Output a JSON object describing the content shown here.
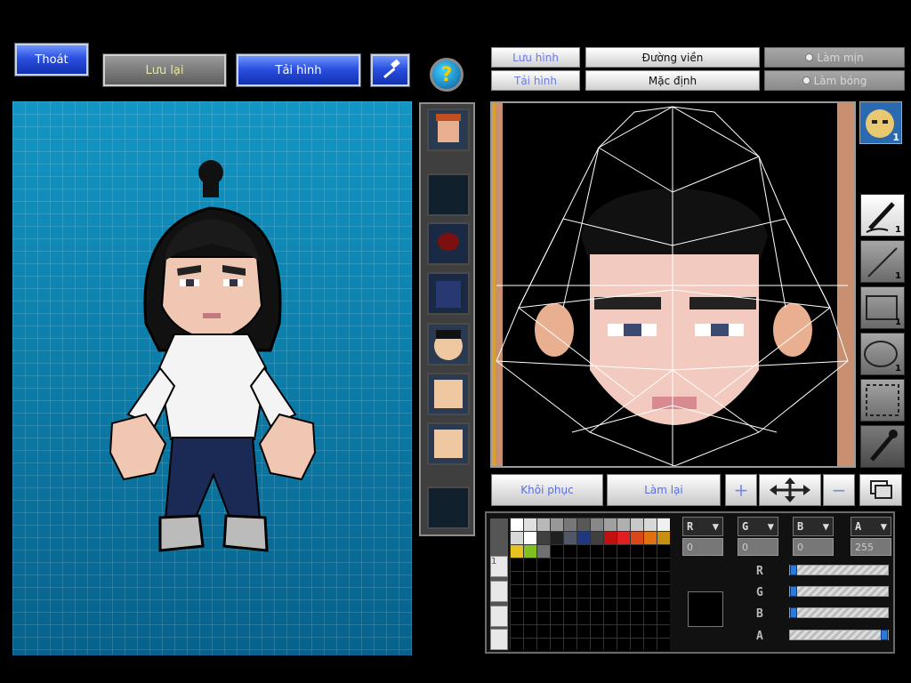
{
  "toolbar": {
    "exit_label": "Thoát",
    "save_label": "Lưu lại",
    "reload_label": "Tải hình",
    "tool_icon": "hammer-icon",
    "help_label": "?"
  },
  "editor_buttons": {
    "save_image": "Lưu hình",
    "load_image": "Tải hình",
    "outline": "Đường viền",
    "default": "Mặc định",
    "smooth": "Làm mịn",
    "gloss": "Làm bóng"
  },
  "edit_row": {
    "restore": "Khôi phục",
    "redo": "Làm lại"
  },
  "tools": [
    {
      "name": "pen",
      "count": "1"
    },
    {
      "name": "line",
      "count": "1"
    },
    {
      "name": "rectangle",
      "count": "1"
    },
    {
      "name": "ellipse",
      "count": "1"
    },
    {
      "name": "selection",
      "count": ""
    },
    {
      "name": "eyedropper",
      "count": ""
    }
  ],
  "face_badge_count": "1",
  "color": {
    "channels": [
      {
        "key": "r",
        "label": "R",
        "value": "0"
      },
      {
        "key": "g",
        "label": "G",
        "value": "0"
      },
      {
        "key": "b",
        "label": "B",
        "value": "0"
      },
      {
        "key": "a",
        "label": "A",
        "value": "255"
      }
    ],
    "sliders": [
      {
        "label": "R",
        "level": 0.0
      },
      {
        "label": "G",
        "level": 0.0
      },
      {
        "label": "B",
        "level": 0.0
      },
      {
        "label": "A",
        "level": 1.0
      }
    ],
    "layer_tab_active": "1",
    "palette": [
      "#ffffff",
      "#e0e0e0",
      "#b8b8b8",
      "#989898",
      "#787878",
      "#585858",
      "#888888",
      "#a0a0a0",
      "#b0b0b0",
      "#c8c8c8",
      "#d8d8d8",
      "#f0f0f0",
      "#d8d8d8",
      "#ffffff",
      "#404040",
      "#202020",
      "#505868",
      "#203880",
      "#404040",
      "#c01010",
      "#e02020",
      "#d84818",
      "#e07010",
      "#c89010",
      "#e8c020",
      "#80c020",
      "#707070"
    ],
    "accent": "#2c7ad8"
  }
}
